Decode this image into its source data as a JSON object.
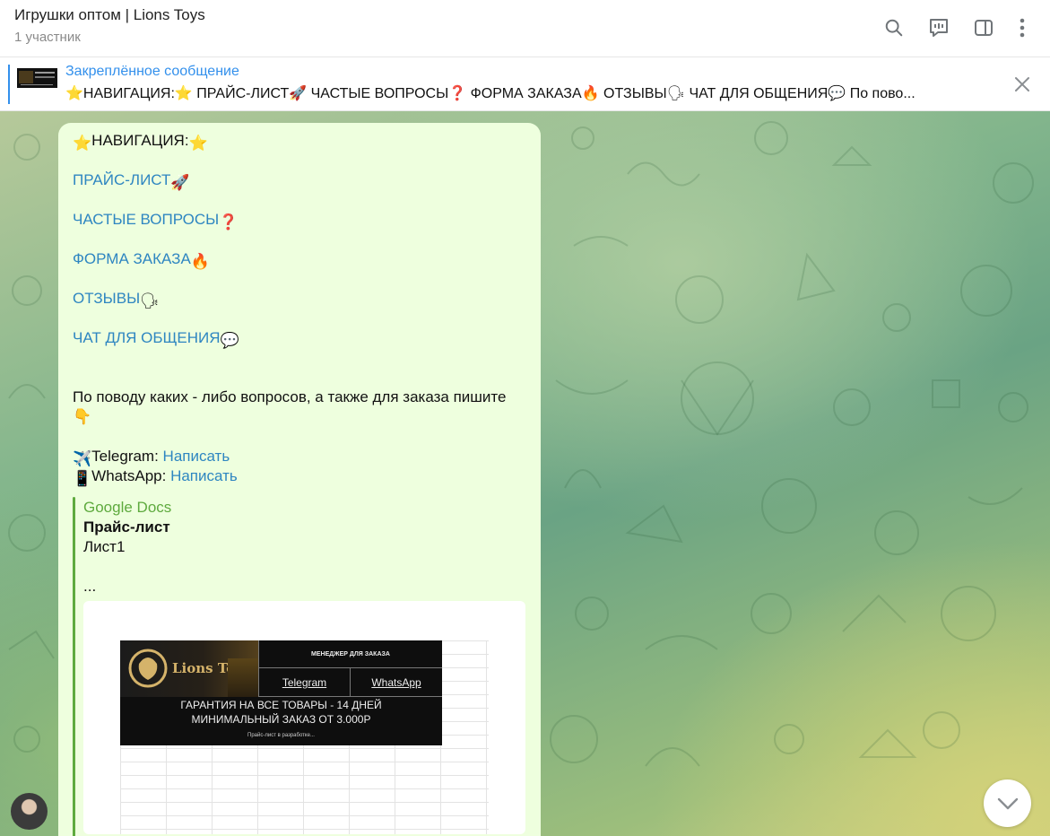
{
  "header": {
    "title": "Игрушки оптом | Lions Toys",
    "subtitle": "1 участник",
    "icons": [
      "search-icon",
      "video-chat-icon",
      "sidebar-toggle-icon",
      "more-icon"
    ]
  },
  "pinned": {
    "label": "Закреплённое сообщение",
    "text": "⭐️НАВИГАЦИЯ:⭐️  ПРАЙС-ЛИСТ🚀  ЧАСТЫЕ ВОПРОСЫ❓  ФОРМА ЗАКАЗА🔥  ОТЗЫВЫ🗣  ЧАТ ДЛЯ ОБЩЕНИЯ💬  По пово..."
  },
  "message": {
    "nav_title": "НАВИГАЦИЯ:",
    "star": "⭐",
    "links": [
      {
        "label": "ПРАЙС-ЛИСТ",
        "emoji": "🚀"
      },
      {
        "label": "ЧАСТЫЕ ВОПРОСЫ",
        "emoji": "❓"
      },
      {
        "label": "ФОРМА ЗАКАЗА",
        "emoji": "🔥"
      },
      {
        "label": "ОТЗЫВЫ",
        "emoji": "🗣"
      },
      {
        "label": "ЧАТ ДЛЯ ОБЩЕНИЯ",
        "emoji": "💬"
      }
    ],
    "contact_text": "По поводу каких - либо вопросов, а также для заказа пишите",
    "point_down": "👇",
    "telegram": {
      "emoji": "✈️",
      "label": "Telegram:",
      "link": "Написать"
    },
    "whatsapp": {
      "emoji": "📱",
      "label": "WhatsApp:",
      "link": "Написать"
    }
  },
  "preview": {
    "site": "Google Docs",
    "title": "Прайс-лист",
    "description": "Лист1",
    "ellipsis": "...",
    "image": {
      "brand": "Lions Toys",
      "manager": "МЕНЕДЖЕР ДЛЯ ЗАКАЗА",
      "telegram": "Telegram",
      "whatsapp": "WhatsApp",
      "guarantee": "ГАРАНТИЯ НА ВСЕ ТОВАРЫ - 14 ДНЕЙ",
      "min_order": "МИНИМАЛЬНЫЙ ЗАКАЗ ОТ 3.000Р",
      "note": "Прайс-лист в разработке..."
    }
  },
  "colors": {
    "accent": "#3390ec",
    "link": "#2e86c1",
    "bubble": "#eeffde",
    "preview_accent": "#5eaa3e"
  }
}
